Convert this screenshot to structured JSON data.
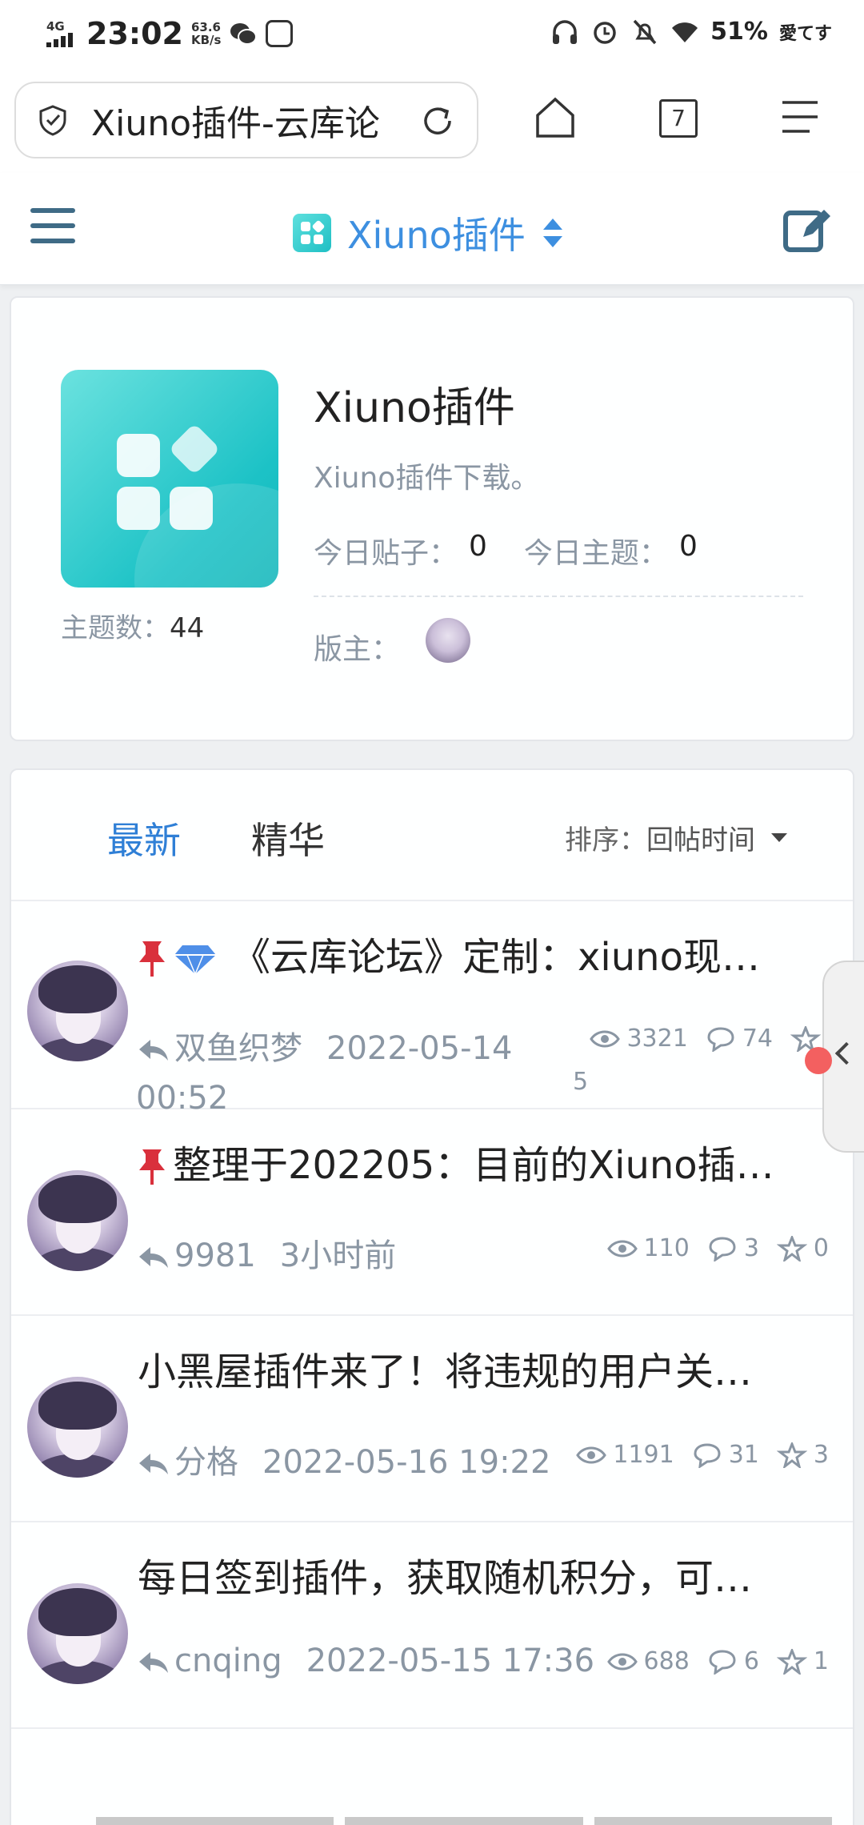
{
  "status_bar": {
    "network": "4G",
    "time": "23:02",
    "speed": "63.6",
    "speed_unit": "KB/s",
    "battery": "51%",
    "carrier": "愛てす"
  },
  "browser": {
    "url_text": "Xiuno插件-云库论坛",
    "tab_count": "7"
  },
  "forum_nav": {
    "title": "Xiuno插件"
  },
  "forum_info": {
    "name": "Xiuno插件",
    "description": "Xiuno插件下载。",
    "today_posts_label": "今日贴子：",
    "today_posts": "0",
    "today_topics_label": "今日主题：",
    "today_topics": "0",
    "topic_count_label": "主题数：",
    "topic_count": "44",
    "moderator_label": "版主："
  },
  "list": {
    "tabs": [
      "最新",
      "精华"
    ],
    "sort_label": "排序：",
    "sort_value": "回帖时间"
  },
  "threads": [
    {
      "title": "《云库论坛》定制：xiuno现…",
      "author": "双鱼织梦",
      "time": "2022-05-14",
      "time2": "00:52",
      "views": "3321",
      "replies": "74",
      "likes": "5",
      "pinned": true,
      "gem": true
    },
    {
      "title": "整理于202205：目前的Xiuno插…",
      "author": "9981",
      "time": "3小时前",
      "views": "110",
      "replies": "3",
      "likes": "0",
      "pinned": true,
      "gem": false
    },
    {
      "title": "小黑屋插件来了！将违规的用户关…",
      "author": "分格",
      "time": "2022-05-16 19:22",
      "views": "1191",
      "replies": "31",
      "likes": "3",
      "pinned": false,
      "gem": false
    },
    {
      "title": "每日签到插件，获取随机积分，可…",
      "author": "cnqing",
      "time": "2022-05-15 17:36",
      "views": "688",
      "replies": "6",
      "likes": "1",
      "pinned": false,
      "gem": false
    }
  ],
  "colors": {
    "accent": "#2f7fd6",
    "nav_icon": "#3f6b86",
    "pin": "#d9303c",
    "teal": "#1cc2c6"
  }
}
